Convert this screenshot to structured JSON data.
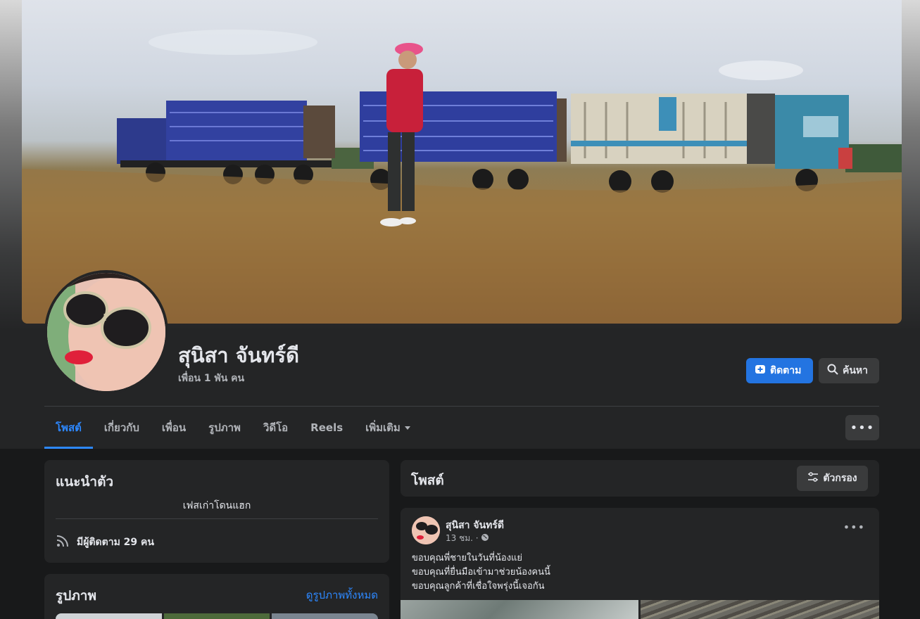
{
  "profile": {
    "name": "สุนิสา จันทร์ดี",
    "friends": "เพื่อน 1 พัน คน",
    "follow_label": "ติดตาม",
    "search_label": "ค้นหา"
  },
  "tabs": [
    {
      "label": "โพสต์",
      "active": true
    },
    {
      "label": "เกี่ยวกับ"
    },
    {
      "label": "เพื่อน"
    },
    {
      "label": "รูปภาพ"
    },
    {
      "label": "วิดีโอ"
    },
    {
      "label": "Reels"
    },
    {
      "label": "เพิ่มเติม"
    }
  ],
  "more_icon": "ellipsis-icon",
  "intro": {
    "title": "แนะนำตัว",
    "bio": "เฟสเก่าโดนแฮก",
    "followers": "มีผู้ติดตาม 29 คน"
  },
  "photos": {
    "title": "รูปภาพ",
    "see_all": "ดูรูปภาพทั้งหมด"
  },
  "posts": {
    "title": "โพสต์",
    "filter_label": "ตัวกรอง"
  },
  "post": {
    "author": "สุนิสา จันทร์ดี",
    "time": "13 ชม. ·",
    "lines": [
      "ขอบคุณพี่ชายในวันที่น้องแย่",
      "ขอบคุณที่ยื่นมือเข้ามาช่วยน้องคนนี้",
      "ขอบคุณลูกค้าที่เชื่อใจพรุ่งนี้เจอกัน"
    ]
  },
  "colors": {
    "accent": "#2374e1",
    "link": "#2d88ff",
    "background": "#18191a",
    "card": "#242526"
  }
}
